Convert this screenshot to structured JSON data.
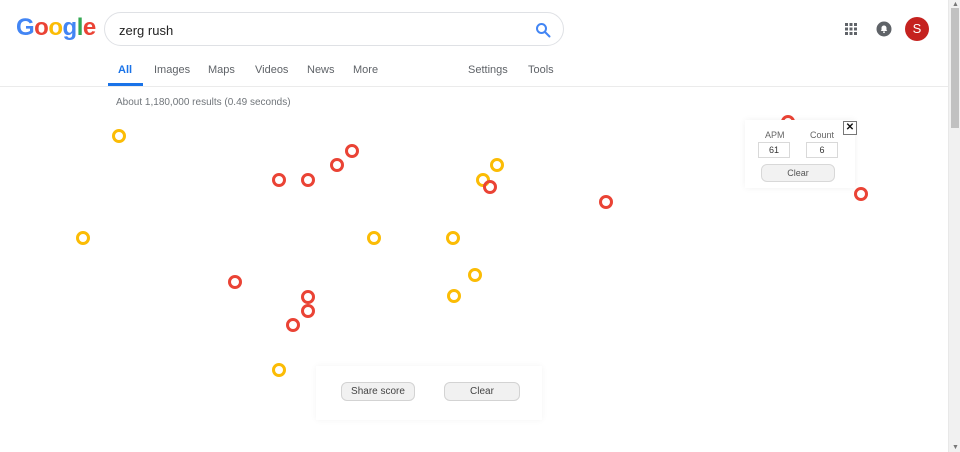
{
  "logo": {
    "text": "Google",
    "letters": [
      "G",
      "o",
      "o",
      "g",
      "l",
      "e"
    ],
    "colors": [
      "#4285f4",
      "#ea4335",
      "#fbbc05",
      "#4285f4",
      "#34a853",
      "#ea4335"
    ]
  },
  "search": {
    "value": "zerg rush"
  },
  "tabs": [
    {
      "label": "All"
    },
    {
      "label": "Images"
    },
    {
      "label": "Maps"
    },
    {
      "label": "Videos"
    },
    {
      "label": "News"
    },
    {
      "label": "More"
    },
    {
      "label": "Settings"
    },
    {
      "label": "Tools"
    }
  ],
  "result_stats": "About 1,180,000 results (0.49 seconds)",
  "avatar_letter": "S",
  "score": {
    "apm_label": "APM",
    "count_label": "Count",
    "apm": "61",
    "count": "6",
    "clear": "Clear",
    "close": "✕"
  },
  "bottom": {
    "share": "Share score",
    "clear": "Clear"
  },
  "zerg_colors": {
    "red": "#ea4335",
    "yellow": "#fbbc05"
  }
}
